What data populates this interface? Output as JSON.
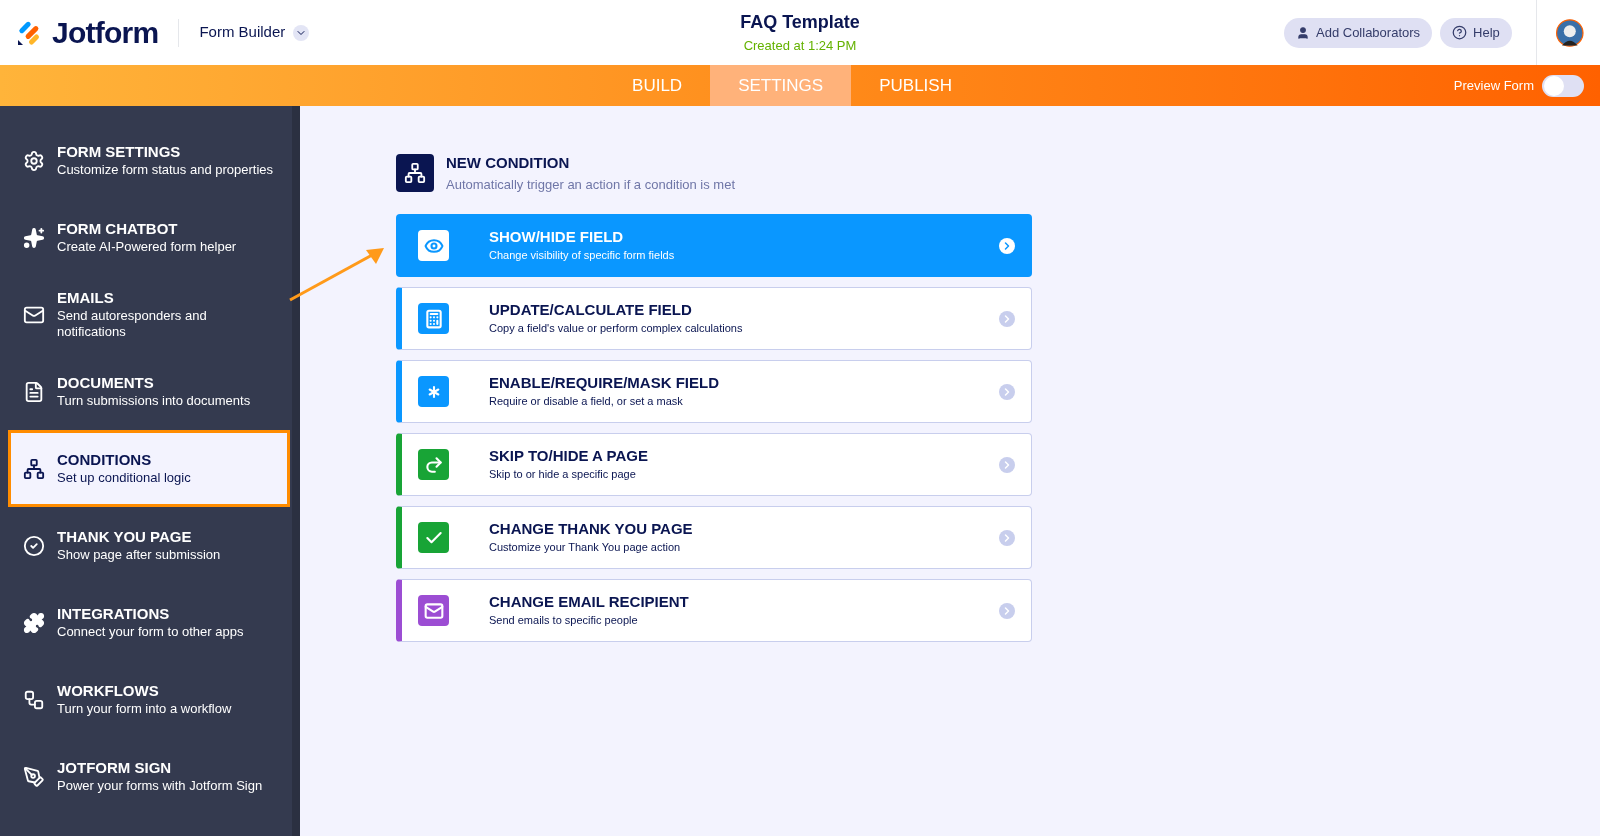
{
  "header": {
    "brand": "Jotform",
    "builder": "Form Builder",
    "title": "FAQ Template",
    "subtitle": "Created at 1:24 PM",
    "buttons": [
      "Add Collaborators",
      "Help"
    ]
  },
  "tabs": [
    {
      "label": "BUILD",
      "selected": false
    },
    {
      "label": "SETTINGS",
      "selected": true
    },
    {
      "label": "PUBLISH",
      "selected": false
    }
  ],
  "preview": {
    "label": "Preview Form",
    "on": false
  },
  "sidebar": {
    "items": [
      {
        "title": "FORM SETTINGS",
        "description": "Customize form status and properties",
        "selected": false
      },
      {
        "title": "FORM CHATBOT",
        "description": "Create AI-Powered form helper",
        "selected": false
      },
      {
        "title": "EMAILS",
        "description": "Send autoresponders and notifications",
        "selected": false
      },
      {
        "title": "DOCUMENTS",
        "description": "Turn submissions into documents",
        "selected": false
      },
      {
        "title": "CONDITIONS",
        "description": "Set up conditional logic",
        "selected": true
      },
      {
        "title": "THANK YOU PAGE",
        "description": "Show page after submission",
        "selected": false
      },
      {
        "title": "INTEGRATIONS",
        "description": "Connect your form to other apps",
        "selected": false
      },
      {
        "title": "WORKFLOWS",
        "description": "Turn your form into a workflow",
        "selected": false
      },
      {
        "title": "JOTFORM SIGN",
        "description": "Power your forms with Jotform Sign",
        "selected": false
      }
    ]
  },
  "new_condition": {
    "title": "NEW CONDITION",
    "description": "Automatically trigger an action if a condition is met"
  },
  "conditions": [
    {
      "title": "SHOW/HIDE FIELD",
      "description": "Change visibility of specific form fields",
      "color": "#0a97ff",
      "selected": true
    },
    {
      "title": "UPDATE/CALCULATE FIELD",
      "description": "Copy a field's value or perform complex calculations",
      "color": "#0a97ff",
      "selected": false
    },
    {
      "title": "ENABLE/REQUIRE/MASK FIELD",
      "description": "Require or disable a field, or set a mask",
      "color": "#0a97ff",
      "selected": false
    },
    {
      "title": "SKIP TO/HIDE A PAGE",
      "description": "Skip to or hide a specific page",
      "color": "#18a436",
      "selected": false
    },
    {
      "title": "CHANGE THANK YOU PAGE",
      "description": "Customize your Thank You page action",
      "color": "#18a436",
      "selected": false
    },
    {
      "title": "CHANGE EMAIL RECIPIENT",
      "description": "Send emails to specific people",
      "color": "#9c4dd3",
      "selected": false
    }
  ]
}
